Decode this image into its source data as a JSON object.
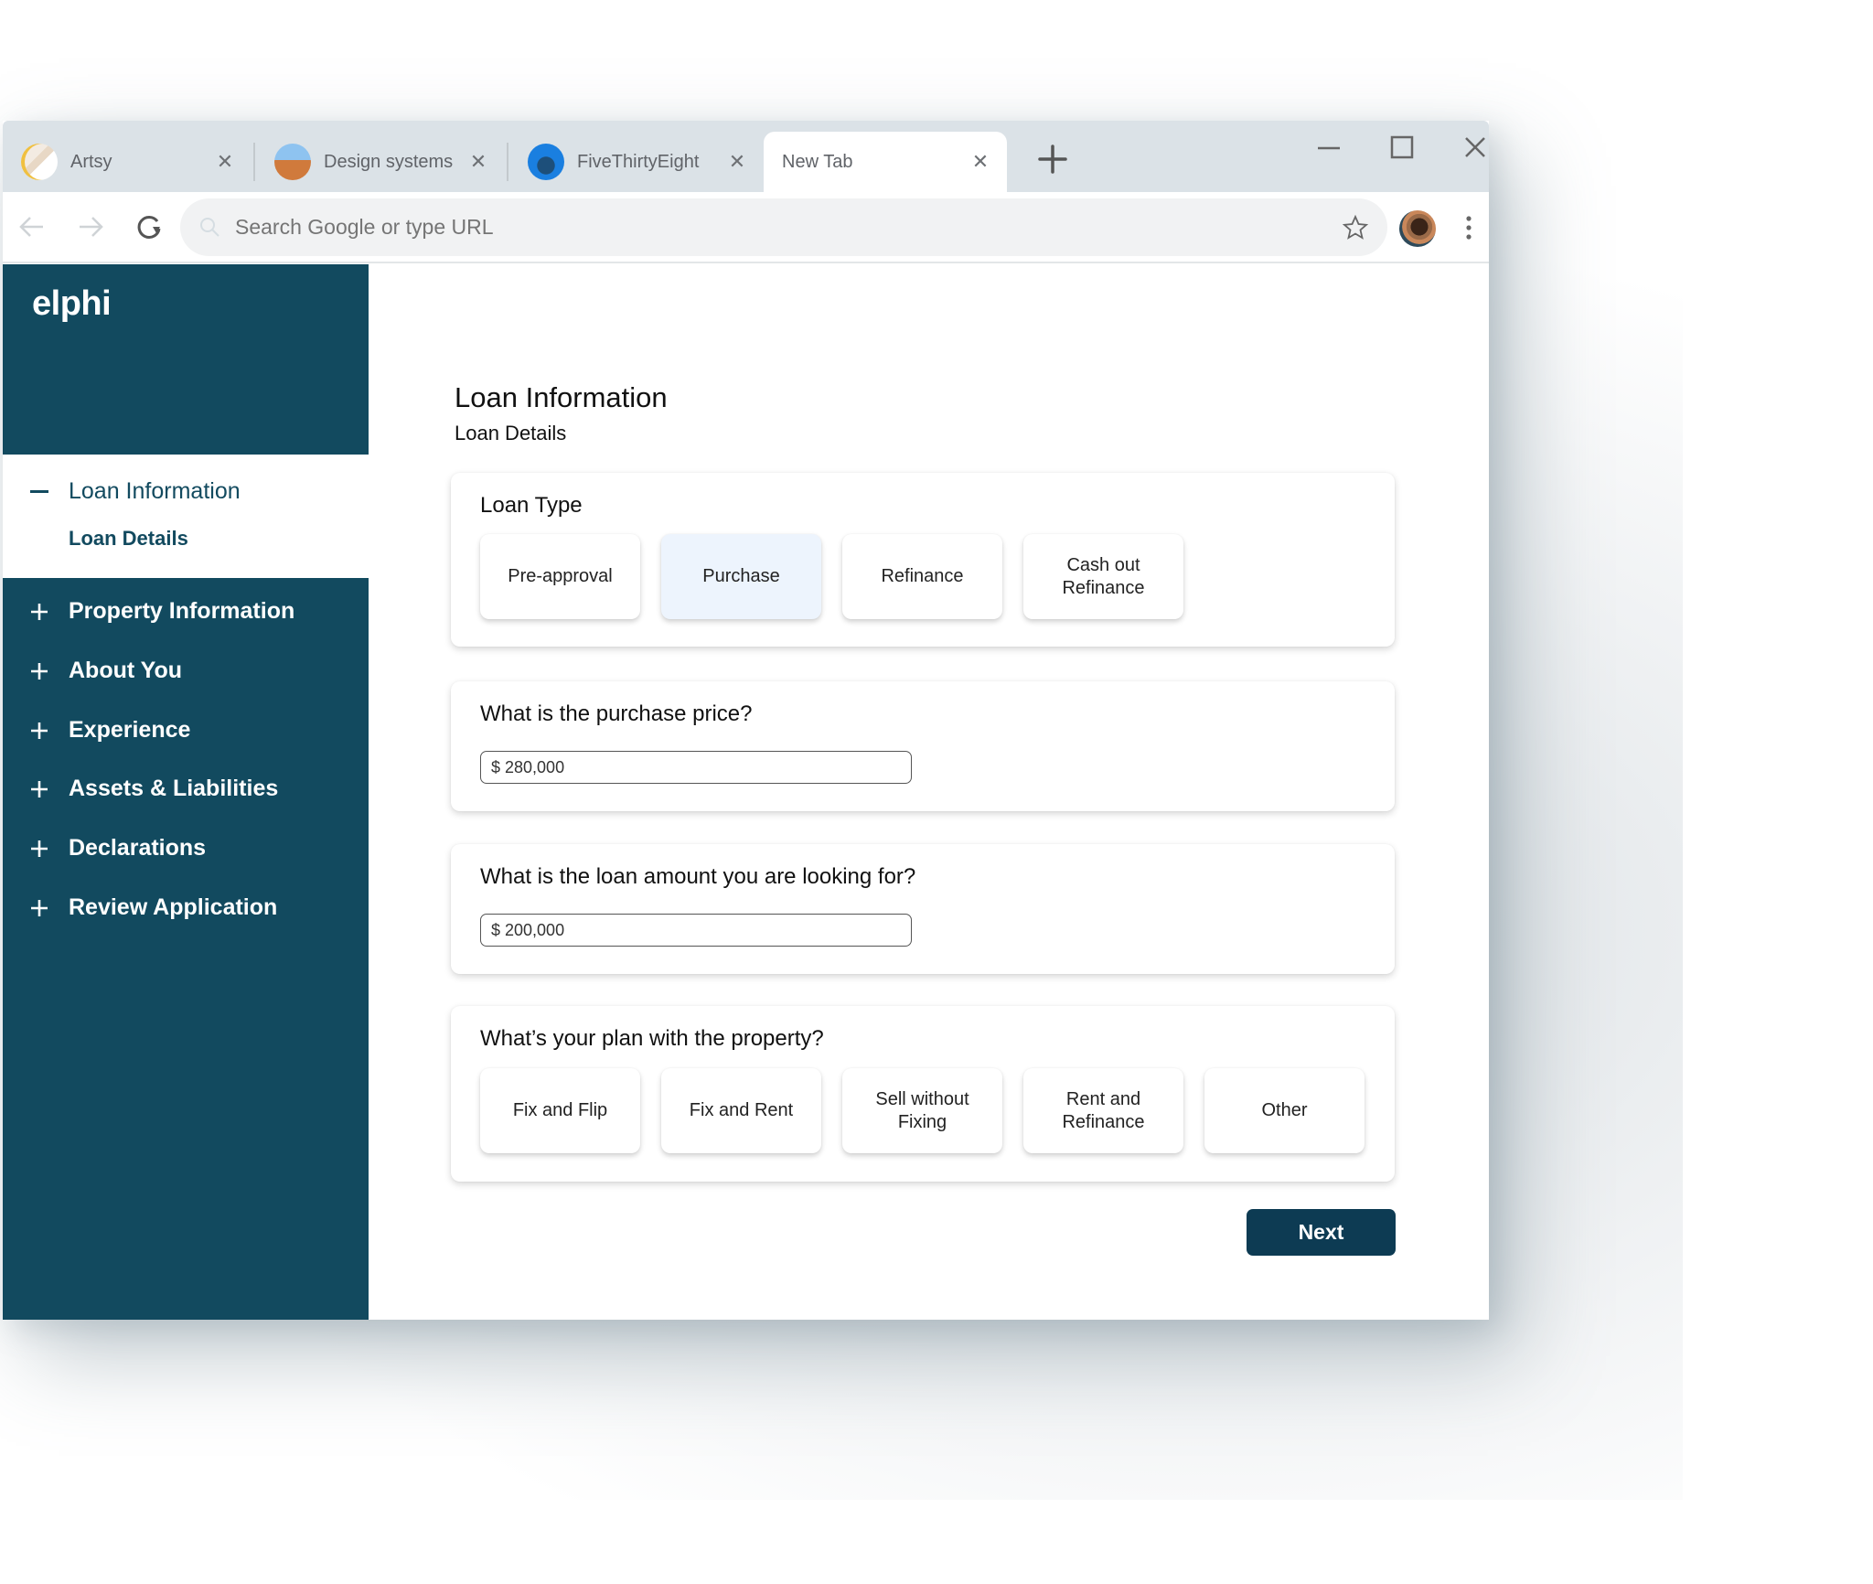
{
  "browser": {
    "tabs": [
      {
        "title": "Artsy",
        "favicon": "artsy-favicon",
        "active": false
      },
      {
        "title": "Design systems",
        "favicon": "design-systems-favicon",
        "active": false
      },
      {
        "title": "FiveThirtyEight",
        "favicon": "fivethirtyeight-favicon",
        "active": false
      },
      {
        "title": "New Tab",
        "favicon": null,
        "active": true
      }
    ],
    "close_glyph": "✕",
    "omnibox_placeholder": "Search Google or type URL",
    "omnibox_value": ""
  },
  "sidebar": {
    "logo": "elphi",
    "active_section": {
      "label": "Loan Information",
      "icon": "minus-icon",
      "subitem": "Loan Details"
    },
    "items": [
      {
        "label": "Property Information",
        "icon": "plus-icon"
      },
      {
        "label": "About You",
        "icon": "plus-icon"
      },
      {
        "label": "Experience",
        "icon": "plus-icon"
      },
      {
        "label": "Assets & Liabilities",
        "icon": "plus-icon"
      },
      {
        "label": "Declarations",
        "icon": "plus-icon"
      },
      {
        "label": "Review Application",
        "icon": "plus-icon"
      }
    ]
  },
  "main": {
    "title": "Loan Information",
    "subtitle": "Loan Details",
    "loan_type": {
      "label": "Loan Type",
      "selected": "Purchase",
      "options": [
        "Pre-approval",
        "Purchase",
        "Refinance",
        "Cash out Refinance"
      ]
    },
    "purchase_price": {
      "label": "What is the purchase price?",
      "value": "$ 280,000"
    },
    "loan_amount": {
      "label": "What is the loan amount you are looking for?",
      "value": "$ 200,000"
    },
    "plan": {
      "label": "What’s your plan with the property?",
      "selected": null,
      "options": [
        "Fix and Flip",
        "Fix and Rent",
        "Sell without Fixing",
        "Rent and Refinance",
        "Other"
      ]
    },
    "next_label": "Next"
  },
  "colors": {
    "brand": "#124a5f",
    "button_primary": "#0d3b53",
    "selected_option": "#edf4fd",
    "tabbar": "#dbe2e7"
  }
}
